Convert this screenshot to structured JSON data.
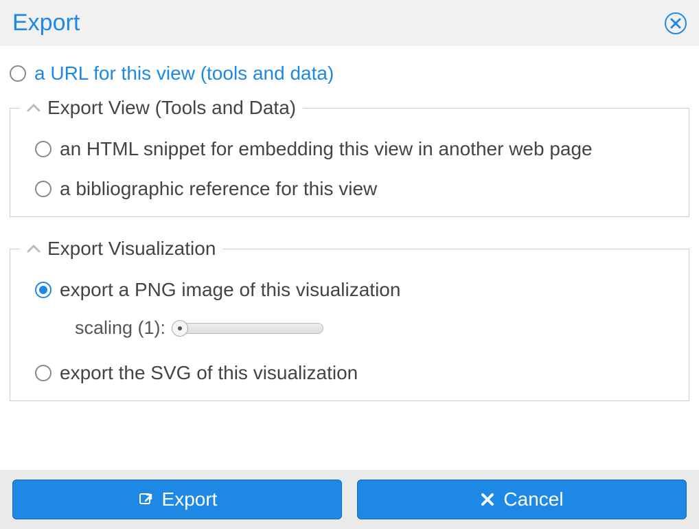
{
  "dialog": {
    "title": "Export"
  },
  "options": {
    "url_view": "a URL for this view (tools and data)",
    "html_snippet": "an HTML snippet for embedding this view in another web page",
    "biblio": "a bibliographic reference for this view",
    "png": "export a PNG image of this visualization",
    "svg": "export the SVG of this visualization"
  },
  "groups": {
    "view": "Export View (Tools and Data)",
    "viz": "Export Visualization"
  },
  "slider": {
    "label": "scaling (1):",
    "value": 1
  },
  "buttons": {
    "export": "Export",
    "cancel": "Cancel"
  },
  "selected_option": "png"
}
